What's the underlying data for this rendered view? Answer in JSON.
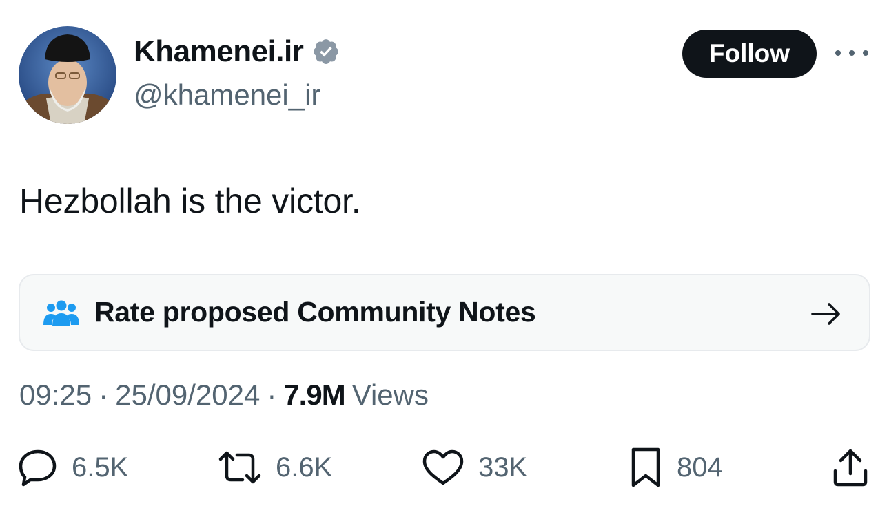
{
  "author": {
    "display_name": "Khamenei.ir",
    "handle": "@khamenei_ir",
    "verified": true,
    "verified_color": "#8b98a5"
  },
  "follow_label": "Follow",
  "tweet": {
    "text": "Hezbollah is the victor."
  },
  "community_notes": {
    "label": "Rate proposed Community Notes",
    "icon": "people-icon",
    "icon_color": "#1d9bf0"
  },
  "meta": {
    "time": "09:25",
    "separator": "·",
    "date": "25/09/2024",
    "views_count": "7.9M",
    "views_label": "Views"
  },
  "actions": {
    "replies": "6.5K",
    "reposts": "6.6K",
    "likes": "33K",
    "bookmarks": "804"
  },
  "colors": {
    "text": "#0f1419",
    "secondary": "#536471",
    "card_border": "#e7eaed",
    "card_bg": "#f7f9f9"
  }
}
